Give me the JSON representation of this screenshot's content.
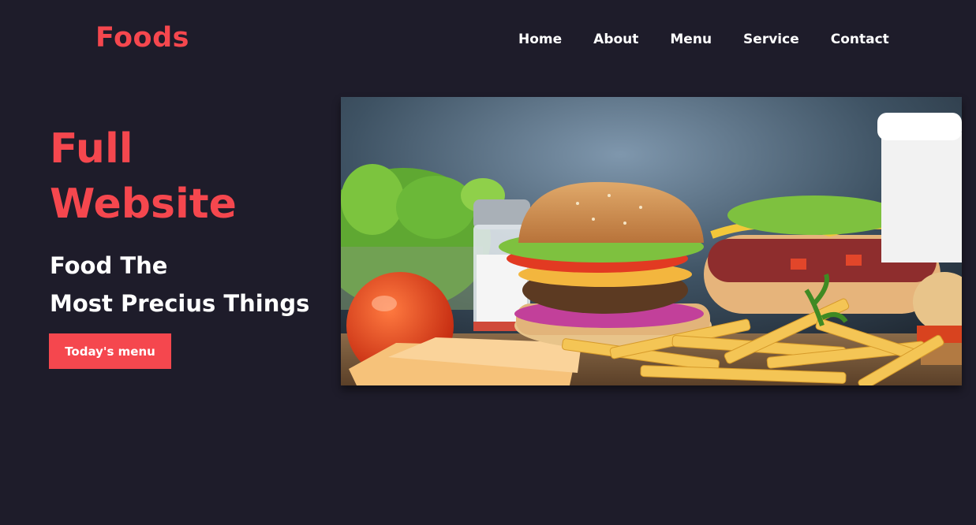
{
  "header": {
    "logo": "Foods",
    "nav": [
      "Home",
      "About",
      "Menu",
      "Service",
      "Contact"
    ]
  },
  "hero": {
    "title_line1": "Full",
    "title_line2": "Website",
    "subtitle_line1": "Food The",
    "subtitle_line2": "Most Precius Things",
    "cta_label": "Today's menu"
  },
  "colors": {
    "background": "#1e1c2a",
    "accent": "#f5474e",
    "text": "#ffffff"
  }
}
